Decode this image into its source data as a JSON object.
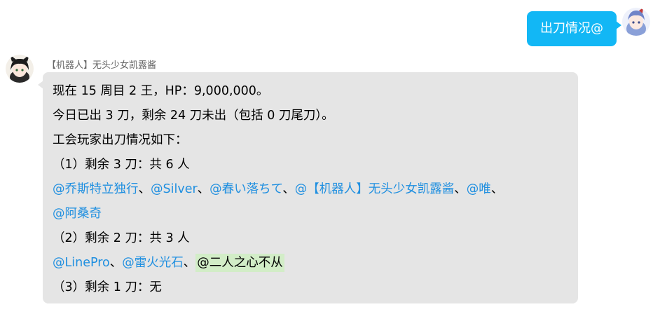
{
  "user_message": {
    "text": "出刀情况@"
  },
  "bot_message": {
    "sender": "【机器人】无头少女凯露酱",
    "line1": "现在 15 周目 2 王，HP：9,000,000。",
    "line2": "今日已出 3 刀，剩余 24 刀未出（包括 0 刀尾刀）。",
    "line3": "工会玩家出刀情况如下：",
    "group1_header": "（1）剩余 3 刀：共 6 人",
    "group1_mentions": [
      "@乔斯特立独行",
      "@Silver",
      "@春い落ちて",
      "@【机器人】无头少女凯露酱",
      "@唯",
      "@阿桑奇"
    ],
    "group2_header": "（2）剩余 2 刀：共 3 人",
    "group2_mentions": [
      "@LinePro",
      "@雷火光石",
      "@二人之心不从"
    ],
    "group3_header": "（3）剩余 1 刀：无",
    "separator": "、"
  },
  "colors": {
    "user_bubble": "#12b7f5",
    "bot_bubble": "#e5e5e5",
    "mention": "#1f8fe0",
    "self_mention_highlight": "#d2edc7"
  },
  "icons": {
    "user_avatar": "anime-girl-avatar",
    "bot_avatar": "anime-catgirl-avatar"
  }
}
